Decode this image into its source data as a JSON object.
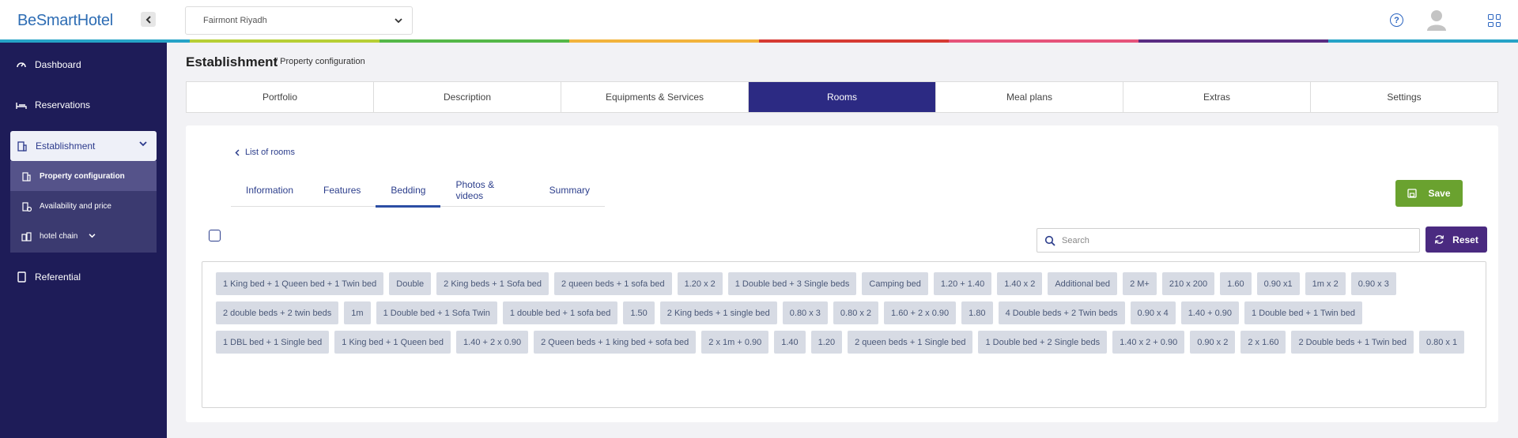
{
  "brand": {
    "logo_a": "BeSmart",
    "logo_b": "Hotel"
  },
  "header": {
    "hotel_select": "Fairmont Riyadh"
  },
  "stripe_colors": [
    "#26a3c7",
    "#b7cf35",
    "#55b848",
    "#f2b33c",
    "#d63b33",
    "#e6537a",
    "#5a2d83",
    "#26a3c7"
  ],
  "sidebar": {
    "dashboard": "Dashboard",
    "reservations": "Reservations",
    "establishment": "Establishment",
    "property_configuration": "Property configuration",
    "availability_and_price": "Availability and price",
    "hotel_chain": "hotel chain",
    "referential": "Referential"
  },
  "page": {
    "title": "Establishment",
    "breadcrumb": "/ Property configuration"
  },
  "tabs": [
    "Portfolio",
    "Description",
    "Equipments & Services",
    "Rooms",
    "Meal plans",
    "Extras",
    "Settings"
  ],
  "active_tab": "Rooms",
  "rooms": {
    "back_link": "List of rooms",
    "subtabs": [
      "Information",
      "Features",
      "Bedding",
      "Photos & videos",
      "Summary"
    ],
    "active_subtab": "Bedding",
    "save_label": "Save",
    "search_placeholder": "Search",
    "reset_label": "Reset",
    "beddings": [
      "1 King bed + 1 Queen bed + 1 Twin bed",
      "Double",
      "2 King beds + 1 Sofa bed",
      "2 queen beds + 1 sofa bed",
      "1.20 x 2",
      "1 Double bed + 3 Single beds",
      "Camping bed",
      "1.20 + 1.40",
      "1.40 x 2",
      "Additional bed",
      "2 M+",
      "210 x 200",
      "1.60",
      "0.90 x1",
      "1m x 2",
      "0.90 x 3",
      "2 double beds + 2 twin beds",
      "1m",
      "1 Double bed + 1 Sofa Twin",
      "1 double bed + 1 sofa bed",
      "1.50",
      "2 King beds + 1 single bed",
      "0.80 x 3",
      "0.80 x 2",
      "1.60 + 2 x 0.90",
      "1.80",
      "4 Double beds + 2 Twin beds",
      "0.90 x 4",
      "1.40 + 0.90",
      "1 Double bed + 1 Twin bed",
      "1 DBL bed + 1 Single bed",
      "1 King bed + 1 Queen bed",
      "1.40 + 2 x 0.90",
      "2 Queen beds + 1 king bed + sofa bed",
      "2 x 1m + 0.90",
      "1.40",
      "1.20",
      "2 queen beds + 1 Single bed",
      "1 Double bed + 2 Single beds",
      "1.40 x 2 + 0.90",
      "0.90 x 2",
      "2 x 1.60",
      "2 Double beds + 1 Twin bed",
      "0.80 x 1"
    ]
  }
}
